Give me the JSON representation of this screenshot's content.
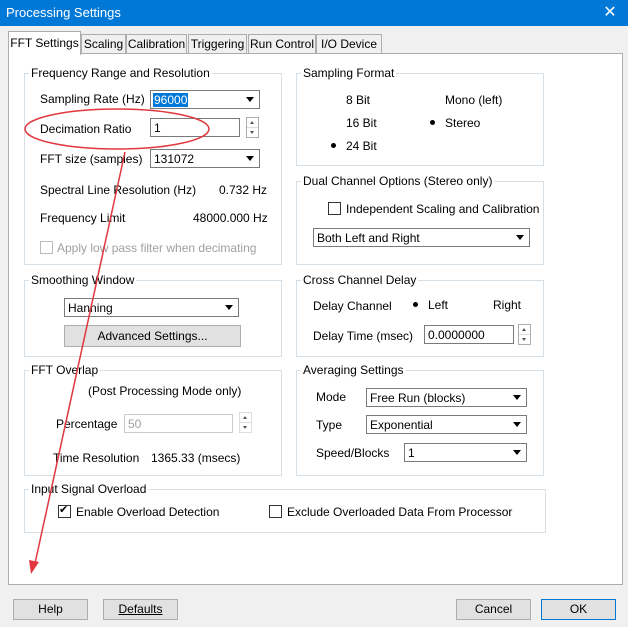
{
  "window": {
    "title": "Processing Settings"
  },
  "tabs": [
    "FFT Settings",
    "Scaling",
    "Calibration",
    "Triggering",
    "Run Control",
    "I/O Device"
  ],
  "freq": {
    "group_label": "Frequency Range and Resolution",
    "sampling_rate_label": "Sampling Rate (Hz)",
    "sampling_rate_value": "96000",
    "decimation_label": "Decimation Ratio",
    "decimation_value": "1",
    "fft_size_label": "FFT size (samples)",
    "fft_size_value": "131072",
    "spectral_label": "Spectral Line Resolution (Hz)",
    "spectral_value": "0.732 Hz",
    "freq_limit_label": "Frequency Limit",
    "freq_limit_value": "48000.000 Hz",
    "lowpass_label": "Apply low pass filter when decimating"
  },
  "sampling_format": {
    "group_label": "Sampling Format",
    "bit8": "8 Bit",
    "bit16": "16 Bit",
    "bit24": "24 Bit",
    "mono": "Mono (left)",
    "stereo": "Stereo"
  },
  "dual": {
    "group_label": "Dual Channel Options (Stereo only)",
    "independent_label": "Independent Scaling and Calibration",
    "channel_value": "Both Left and Right"
  },
  "smoothing": {
    "group_label": "Smoothing Window",
    "window_value": "Hanning",
    "advanced_button": "Advanced Settings..."
  },
  "cross": {
    "group_label": "Cross Channel Delay",
    "delay_channel_label": "Delay Channel",
    "left": "Left",
    "right": "Right",
    "delay_time_label": "Delay Time (msec)",
    "delay_time_value": "0.0000000"
  },
  "overlap": {
    "group_label": "FFT Overlap",
    "note": "(Post Processing Mode only)",
    "percentage_label": "Percentage",
    "percentage_value": "50",
    "time_res_label": "Time Resolution",
    "time_res_value": "1365.33 (msecs)"
  },
  "averaging": {
    "group_label": "Averaging Settings",
    "mode_label": "Mode",
    "mode_value": "Free Run (blocks)",
    "type_label": "Type",
    "type_value": "Exponential",
    "speed_label": "Speed/Blocks",
    "speed_value": "1"
  },
  "overload": {
    "group_label": "Input Signal Overload",
    "enable_label": "Enable Overload Detection",
    "exclude_label": "Exclude Overloaded Data From Processor"
  },
  "buttons": {
    "help": "Help",
    "defaults": "Defaults",
    "cancel": "Cancel",
    "ok": "OK"
  },
  "colors": {
    "annotation": "#e0383e",
    "titlebar": "#0078d7",
    "selection": "#0078d7"
  }
}
